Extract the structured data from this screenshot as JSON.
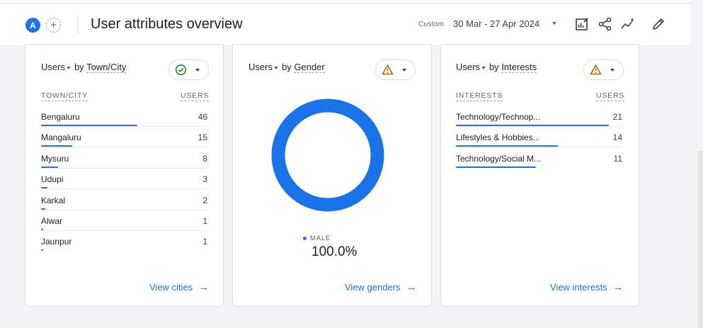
{
  "header": {
    "avatar_letter": "A",
    "add_label": "+",
    "title": "User attributes overview",
    "custom_label": "Custom",
    "date_range": "30 Mar - 27 Apr 2024",
    "icons": [
      "customize-report-icon",
      "share-icon",
      "insights-icon",
      "edit-icon"
    ]
  },
  "cards": {
    "city": {
      "metric": "Users",
      "by": "by",
      "dimension": "Town/City",
      "status": "check",
      "col_dim": "TOWN/CITY",
      "col_metric": "USERS",
      "rows": [
        {
          "label": "Bengaluru",
          "value": "46",
          "share": 1.0
        },
        {
          "label": "Mangaluru",
          "value": "15",
          "share": 0.326
        },
        {
          "label": "Mysuru",
          "value": "8",
          "share": 0.174
        },
        {
          "label": "Udupi",
          "value": "3",
          "share": 0.065
        },
        {
          "label": "Karkal",
          "value": "2",
          "share": 0.043
        },
        {
          "label": "Alwar",
          "value": "1",
          "share": 0.022
        },
        {
          "label": "Jaunpur",
          "value": "1",
          "share": 0.022
        }
      ],
      "link": "View cities"
    },
    "gender": {
      "metric": "Users",
      "by": "by",
      "dimension": "Gender",
      "status": "warning",
      "legend": "MALE",
      "percent": "100.0%",
      "share": 1.0,
      "link": "View genders"
    },
    "interests": {
      "metric": "Users",
      "by": "by",
      "dimension": "Interests",
      "status": "warning",
      "col_dim": "INTERESTS",
      "col_metric": "USERS",
      "rows": [
        {
          "label": "Technology/Technop...",
          "value": "21",
          "share": 1.0
        },
        {
          "label": "Lifestyles & Hobbies...",
          "value": "14",
          "share": 0.667
        },
        {
          "label": "Technology/Social M...",
          "value": "11",
          "share": 0.524
        }
      ],
      "link": "View interests"
    }
  },
  "colors": {
    "accent": "#1a73e8",
    "check": "#188038",
    "warning": "#b06000"
  }
}
